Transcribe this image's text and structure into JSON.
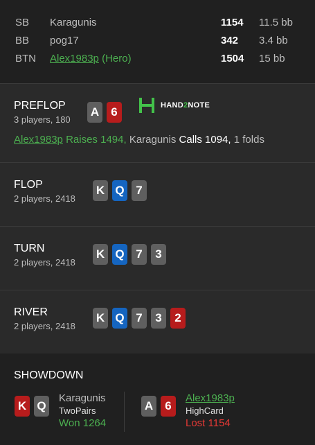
{
  "players": [
    {
      "pos": "SB",
      "name": "Karagunis",
      "stack": "1154",
      "bb": "11.5 bb"
    },
    {
      "pos": "BB",
      "name": "pog17",
      "stack": "342",
      "bb": "3.4 bb"
    },
    {
      "pos": "BTN",
      "name": "Alex1983p",
      "hero_tag": "(Hero)",
      "stack": "1504",
      "bb": "15 bb"
    }
  ],
  "preflop": {
    "title": "PREFLOP",
    "sub": "3 players, 180",
    "cards": [
      {
        "rank": "A",
        "color": "gray"
      },
      {
        "rank": "6",
        "color": "red"
      }
    ],
    "logo_text_a": "HAND",
    "logo_text_b": "2",
    "logo_text_c": "NOTE",
    "action": {
      "hero": "Alex1983p",
      "hero_action": "Raises 1494,",
      "villain": "Karagunis",
      "villain_action": "Calls 1094,",
      "folds": "1 folds"
    }
  },
  "flop": {
    "title": "FLOP",
    "sub": "2 players, 2418",
    "cards": [
      {
        "rank": "K",
        "color": "gray"
      },
      {
        "rank": "Q",
        "color": "blue"
      },
      {
        "rank": "7",
        "color": "gray"
      }
    ]
  },
  "turn": {
    "title": "TURN",
    "sub": "2 players, 2418",
    "cards": [
      {
        "rank": "K",
        "color": "gray"
      },
      {
        "rank": "Q",
        "color": "blue"
      },
      {
        "rank": "7",
        "color": "gray"
      },
      {
        "rank": "3",
        "color": "gray"
      }
    ]
  },
  "river": {
    "title": "RIVER",
    "sub": "2 players, 2418",
    "cards": [
      {
        "rank": "K",
        "color": "gray"
      },
      {
        "rank": "Q",
        "color": "blue"
      },
      {
        "rank": "7",
        "color": "gray"
      },
      {
        "rank": "3",
        "color": "gray"
      },
      {
        "rank": "2",
        "color": "red"
      }
    ]
  },
  "showdown": {
    "title": "SHOWDOWN",
    "left": {
      "name": "Karagunis",
      "hand": "TwoPairs",
      "result": "Won 1264",
      "cards": [
        {
          "rank": "K",
          "color": "red"
        },
        {
          "rank": "Q",
          "color": "gray"
        }
      ]
    },
    "right": {
      "name": "Alex1983p",
      "hand": "HighCard",
      "result": "Lost 1154",
      "cards": [
        {
          "rank": "A",
          "color": "gray"
        },
        {
          "rank": "6",
          "color": "red"
        }
      ]
    }
  },
  "colors": {
    "green": "#4caf50",
    "red_card": "#b71c1c",
    "blue_card": "#1565c0",
    "gray_card": "#5f5f5f",
    "loss": "#e53935"
  }
}
